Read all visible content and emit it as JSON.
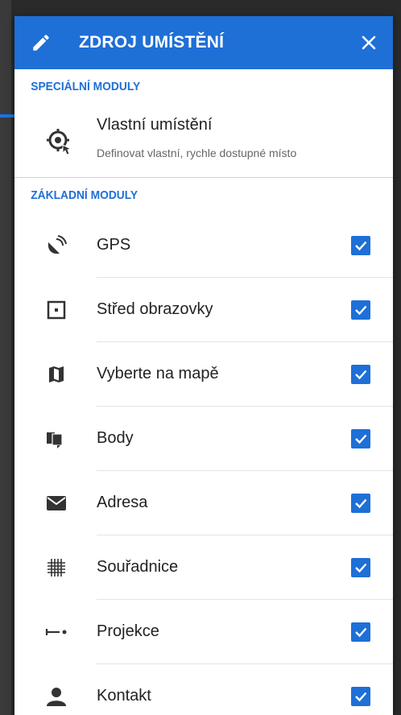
{
  "dialog": {
    "title": "ZDROJ UMÍSTĚNÍ",
    "header_color": "#1e6fd6",
    "edit_icon": "pencil-icon",
    "close_icon": "close-icon"
  },
  "special_section": {
    "header": "SPECIÁLNÍ MODULY",
    "item": {
      "title": "Vlastní umístění",
      "subtitle": "Definovat vlastní, rychle dostupné místo",
      "icon": "custom-location-icon"
    }
  },
  "basic_section": {
    "header": "ZÁKLADNÍ MODULY",
    "modules": [
      {
        "label": "GPS",
        "icon": "gps-satellite-icon",
        "checked": true
      },
      {
        "label": "Střed obrazovky",
        "icon": "screen-center-icon",
        "checked": true
      },
      {
        "label": "Vyberte na mapě",
        "icon": "map-icon",
        "checked": true
      },
      {
        "label": "Body",
        "icon": "points-icon",
        "checked": true
      },
      {
        "label": "Adresa",
        "icon": "envelope-icon",
        "checked": true
      },
      {
        "label": "Souřadnice",
        "icon": "grid-icon",
        "checked": true
      },
      {
        "label": "Projekce",
        "icon": "projection-icon",
        "checked": true
      },
      {
        "label": "Kontakt",
        "icon": "person-icon",
        "checked": true
      }
    ]
  }
}
